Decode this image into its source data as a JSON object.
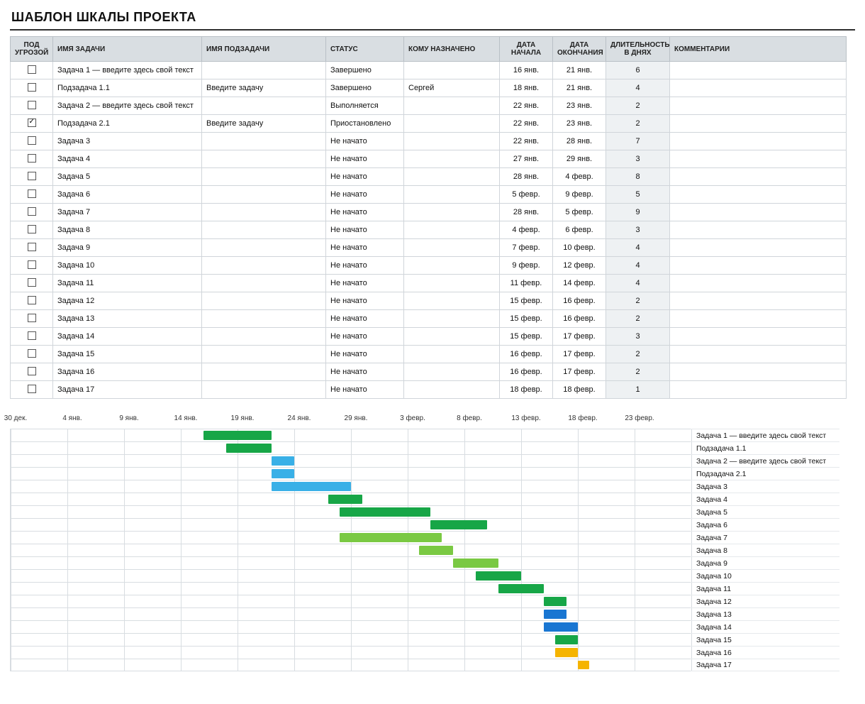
{
  "title": "ШАБЛОН ШКАЛЫ ПРОЕКТА",
  "columns": {
    "risk": "ПОД УГРОЗОЙ",
    "name": "ИМЯ ЗАДАЧИ",
    "sub": "ИМЯ ПОДЗАДАЧИ",
    "status": "СТАТУС",
    "assigned": "КОМУ НАЗНАЧЕНО",
    "start": "ДАТА НАЧАЛА",
    "end": "ДАТА ОКОНЧАНИЯ",
    "dur": "ДЛИТЕЛЬНОСТЬ В ДНЯХ",
    "comment": "КОММЕНТАРИИ"
  },
  "rows": [
    {
      "risk": false,
      "name": "Задача 1 — введите здесь свой текст",
      "sub": "",
      "status": "Завершено",
      "assigned": "",
      "start": "16 янв.",
      "end": "21 янв.",
      "dur": "6",
      "comment": ""
    },
    {
      "risk": false,
      "name": "Подзадача 1.1",
      "sub": "Введите задачу",
      "status": "Завершено",
      "assigned": "Сергей",
      "start": "18 янв.",
      "end": "21 янв.",
      "dur": "4",
      "comment": ""
    },
    {
      "risk": false,
      "name": "Задача 2 — введите здесь свой текст",
      "sub": "",
      "status": "Выполняется",
      "assigned": "",
      "start": "22 янв.",
      "end": "23 янв.",
      "dur": "2",
      "comment": ""
    },
    {
      "risk": true,
      "name": "Подзадача 2.1",
      "sub": "Введите задачу",
      "status": "Приостановлено",
      "assigned": "",
      "start": "22 янв.",
      "end": "23 янв.",
      "dur": "2",
      "comment": ""
    },
    {
      "risk": false,
      "name": "Задача 3",
      "sub": "",
      "status": "Не начато",
      "assigned": "",
      "start": "22 янв.",
      "end": "28 янв.",
      "dur": "7",
      "comment": ""
    },
    {
      "risk": false,
      "name": "Задача 4",
      "sub": "",
      "status": "Не начато",
      "assigned": "",
      "start": "27 янв.",
      "end": "29 янв.",
      "dur": "3",
      "comment": ""
    },
    {
      "risk": false,
      "name": "Задача 5",
      "sub": "",
      "status": "Не начато",
      "assigned": "",
      "start": "28 янв.",
      "end": "4 февр.",
      "dur": "8",
      "comment": ""
    },
    {
      "risk": false,
      "name": "Задача 6",
      "sub": "",
      "status": "Не начато",
      "assigned": "",
      "start": "5 февр.",
      "end": "9 февр.",
      "dur": "5",
      "comment": ""
    },
    {
      "risk": false,
      "name": "Задача 7",
      "sub": "",
      "status": "Не начато",
      "assigned": "",
      "start": "28 янв.",
      "end": "5 февр.",
      "dur": "9",
      "comment": ""
    },
    {
      "risk": false,
      "name": "Задача 8",
      "sub": "",
      "status": "Не начато",
      "assigned": "",
      "start": "4 февр.",
      "end": "6 февр.",
      "dur": "3",
      "comment": ""
    },
    {
      "risk": false,
      "name": "Задача 9",
      "sub": "",
      "status": "Не начато",
      "assigned": "",
      "start": "7 февр.",
      "end": "10 февр.",
      "dur": "4",
      "comment": ""
    },
    {
      "risk": false,
      "name": "Задача 10",
      "sub": "",
      "status": "Не начато",
      "assigned": "",
      "start": "9 февр.",
      "end": "12 февр.",
      "dur": "4",
      "comment": ""
    },
    {
      "risk": false,
      "name": "Задача 11",
      "sub": "",
      "status": "Не начато",
      "assigned": "",
      "start": "11 февр.",
      "end": "14 февр.",
      "dur": "4",
      "comment": ""
    },
    {
      "risk": false,
      "name": "Задача 12",
      "sub": "",
      "status": "Не начато",
      "assigned": "",
      "start": "15 февр.",
      "end": "16 февр.",
      "dur": "2",
      "comment": ""
    },
    {
      "risk": false,
      "name": "Задача 13",
      "sub": "",
      "status": "Не начато",
      "assigned": "",
      "start": "15 февр.",
      "end": "16 февр.",
      "dur": "2",
      "comment": ""
    },
    {
      "risk": false,
      "name": "Задача 14",
      "sub": "",
      "status": "Не начато",
      "assigned": "",
      "start": "15 февр.",
      "end": "17 февр.",
      "dur": "3",
      "comment": ""
    },
    {
      "risk": false,
      "name": "Задача 15",
      "sub": "",
      "status": "Не начато",
      "assigned": "",
      "start": "16 февр.",
      "end": "17 февр.",
      "dur": "2",
      "comment": ""
    },
    {
      "risk": false,
      "name": "Задача 16",
      "sub": "",
      "status": "Не начато",
      "assigned": "",
      "start": "16 февр.",
      "end": "17 февр.",
      "dur": "2",
      "comment": ""
    },
    {
      "risk": false,
      "name": "Задача 17",
      "sub": "",
      "status": "Не начато",
      "assigned": "",
      "start": "18 февр.",
      "end": "18 февр.",
      "dur": "1",
      "comment": ""
    }
  ],
  "chart_data": {
    "type": "bar",
    "orientation": "horizontal-gantt",
    "x_axis": {
      "origin_label": "30 дек.",
      "origin_day": -1,
      "ticks_days": [
        -1,
        4,
        9,
        14,
        19,
        24,
        29,
        34,
        39,
        44,
        49,
        54,
        59
      ],
      "ticks_labels": [
        "30 дек.",
        "4 янв.",
        "9 янв.",
        "14 янв.",
        "19 янв.",
        "24 янв.",
        "29 янв.",
        "3 февр.",
        "8 февр.",
        "13 февр.",
        "18 февр.",
        "23 февр.",
        ""
      ],
      "domain_days": [
        -1,
        59
      ]
    },
    "colors": {
      "green_dark": "#17a647",
      "green_light": "#7ac943",
      "blue_light": "#39b0e7",
      "blue_dark": "#1976d2",
      "yellow": "#f5b400"
    },
    "series": [
      {
        "label": "Задача 1 — введите здесь свой текст",
        "start_day": 16,
        "end_day": 21,
        "color": "green_dark"
      },
      {
        "label": "Подзадача 1.1",
        "start_day": 18,
        "end_day": 21,
        "color": "green_dark"
      },
      {
        "label": "Задача 2 — введите здесь свой текст",
        "start_day": 22,
        "end_day": 23,
        "color": "blue_light"
      },
      {
        "label": "Подзадача 2.1",
        "start_day": 22,
        "end_day": 23,
        "color": "blue_light"
      },
      {
        "label": "Задача 3",
        "start_day": 22,
        "end_day": 28,
        "color": "blue_light"
      },
      {
        "label": "Задача 4",
        "start_day": 27,
        "end_day": 29,
        "color": "green_dark"
      },
      {
        "label": "Задача 5",
        "start_day": 28,
        "end_day": 35,
        "color": "green_dark"
      },
      {
        "label": "Задача 6",
        "start_day": 36,
        "end_day": 40,
        "color": "green_dark"
      },
      {
        "label": "Задача 7",
        "start_day": 28,
        "end_day": 36,
        "color": "green_light"
      },
      {
        "label": "Задача 8",
        "start_day": 35,
        "end_day": 37,
        "color": "green_light"
      },
      {
        "label": "Задача 9",
        "start_day": 38,
        "end_day": 41,
        "color": "green_light"
      },
      {
        "label": "Задача 10",
        "start_day": 40,
        "end_day": 43,
        "color": "green_dark"
      },
      {
        "label": "Задача 11",
        "start_day": 42,
        "end_day": 45,
        "color": "green_dark"
      },
      {
        "label": "Задача 12",
        "start_day": 46,
        "end_day": 47,
        "color": "green_dark"
      },
      {
        "label": "Задача 13",
        "start_day": 46,
        "end_day": 47,
        "color": "blue_dark"
      },
      {
        "label": "Задача 14",
        "start_day": 46,
        "end_day": 48,
        "color": "blue_dark"
      },
      {
        "label": "Задача 15",
        "start_day": 47,
        "end_day": 48,
        "color": "green_dark"
      },
      {
        "label": "Задача 16",
        "start_day": 47,
        "end_day": 48,
        "color": "yellow"
      },
      {
        "label": "Задача 17",
        "start_day": 49,
        "end_day": 49,
        "color": "yellow"
      }
    ]
  }
}
